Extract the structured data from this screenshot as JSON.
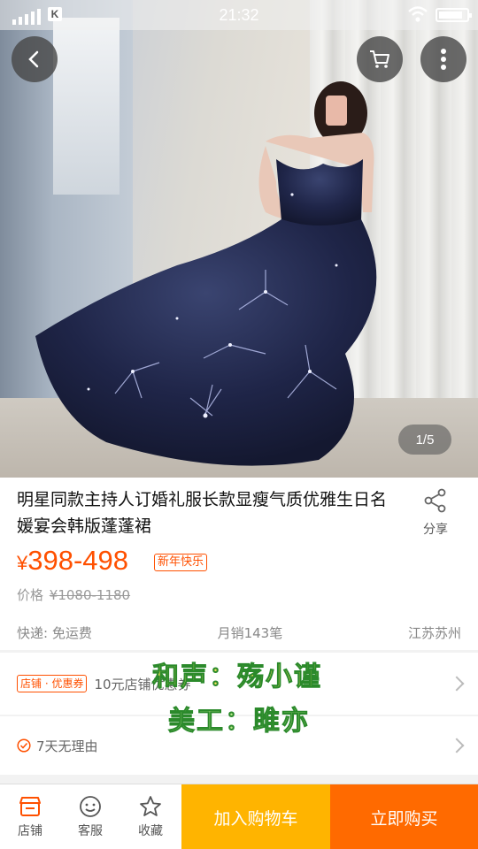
{
  "status_bar": {
    "time": "21:32"
  },
  "hero": {
    "page_indicator": "1/5"
  },
  "product": {
    "title": "明星同款主持人订婚礼服长款显瘦气质优雅生日名媛宴会韩版蓬蓬裙",
    "share_label": "分享",
    "price_symbol": "¥",
    "price": "398-498",
    "promo_tag": "新年快乐",
    "orig_price_label": "价格",
    "orig_price": "¥1080-1180",
    "shipping": "快递: 免运费",
    "monthly_sales": "月销143笔",
    "location": "江苏苏州"
  },
  "coupon": {
    "tag": "店铺 · 优惠券",
    "text": "10元店铺优惠券"
  },
  "returns": {
    "text": "7天无理由"
  },
  "watermarks": {
    "line1": "和声：殇小谨",
    "line2": "美工：雎亦"
  },
  "bottom_bar": {
    "store_label": "店铺",
    "service_label": "客服",
    "favorite_label": "收藏",
    "add_cart_label": "加入购物车",
    "buy_now_label": "立即购买"
  },
  "colors": {
    "accent": "#ff5000",
    "cart_button": "#ffb400",
    "buy_button": "#ff6a00"
  },
  "icons": [
    "back-icon",
    "cart-icon",
    "more-icon",
    "share-icon",
    "check-circle-icon",
    "store-icon",
    "service-icon",
    "star-icon"
  ]
}
